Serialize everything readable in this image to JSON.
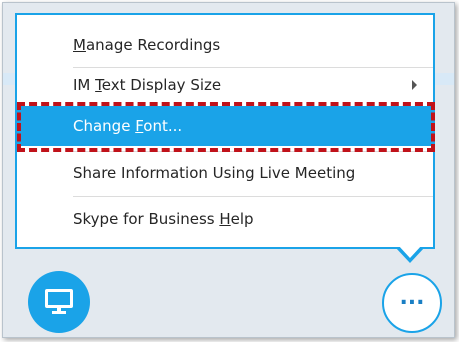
{
  "menu": {
    "items": [
      {
        "pre": "",
        "mnemonic": "M",
        "post": "anage Recordings",
        "has_submenu": false,
        "active": false
      },
      {
        "pre": "IM ",
        "mnemonic": "T",
        "post": "ext Display Size",
        "has_submenu": true,
        "active": false
      },
      {
        "pre": "Change ",
        "mnemonic": "F",
        "post": "ont...",
        "has_submenu": false,
        "active": true
      },
      {
        "pre": "Share Information Using Live Meeting",
        "mnemonic": "",
        "post": "",
        "has_submenu": false,
        "active": false
      },
      {
        "pre": "Skype for Business ",
        "mnemonic": "H",
        "post": "elp",
        "has_submenu": false,
        "active": false
      }
    ]
  },
  "toolbar": {
    "present_icon": "monitor-icon",
    "more_label": "...",
    "more_icon": "ellipsis-icon"
  },
  "colors": {
    "accent": "#1aa3e8",
    "highlight_frame": "#c0121a",
    "menu_text": "#262626"
  }
}
